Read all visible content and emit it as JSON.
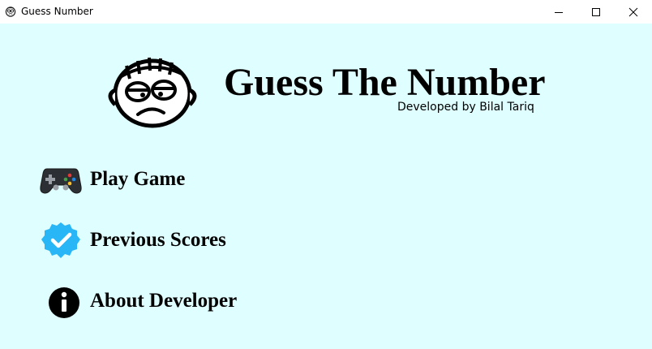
{
  "window": {
    "title": "Guess Number",
    "app_icon": "face-icon",
    "controls": {
      "minimize": "minimize-icon",
      "maximize": "maximize-icon",
      "close": "close-icon"
    }
  },
  "header": {
    "logo_icon": "stitched-face-icon",
    "title": "Guess The Number",
    "subtitle": "Developed by Bilal Tariq"
  },
  "menu": {
    "items": [
      {
        "label": "Play Game",
        "icon": "gamepad-icon"
      },
      {
        "label": "Previous Scores",
        "icon": "verified-badge-icon"
      },
      {
        "label": "About Developer",
        "icon": "info-icon"
      }
    ]
  },
  "colors": {
    "background": "#dffeff",
    "titlebar": "#ffffff",
    "text": "#000000",
    "badge": "#29b6f6"
  }
}
